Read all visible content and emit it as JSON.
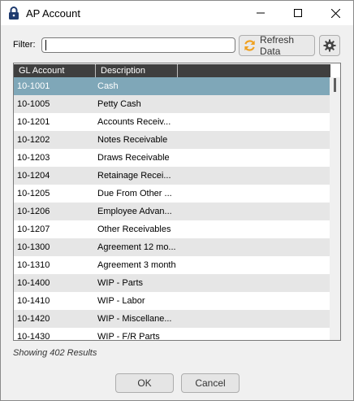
{
  "window": {
    "title": "AP Account"
  },
  "filter": {
    "label": "Filter:",
    "value": ""
  },
  "toolbar": {
    "refresh_label": "Refresh Data"
  },
  "grid": {
    "columns": [
      "GL Account",
      "Description"
    ],
    "rows": [
      {
        "gl": "10-1001",
        "desc": "Cash",
        "selected": true
      },
      {
        "gl": "10-1005",
        "desc": "Petty Cash"
      },
      {
        "gl": "10-1201",
        "desc": "Accounts Receiv..."
      },
      {
        "gl": "10-1202",
        "desc": "Notes Receivable"
      },
      {
        "gl": "10-1203",
        "desc": "Draws Receivable"
      },
      {
        "gl": "10-1204",
        "desc": "Retainage Recei..."
      },
      {
        "gl": "10-1205",
        "desc": "Due From Other ..."
      },
      {
        "gl": "10-1206",
        "desc": "Employee Advan..."
      },
      {
        "gl": "10-1207",
        "desc": "Other Receivables"
      },
      {
        "gl": "10-1300",
        "desc": "Agreement 12 mo..."
      },
      {
        "gl": "10-1310",
        "desc": "Agreement 3 month"
      },
      {
        "gl": "10-1400",
        "desc": "WIP - Parts"
      },
      {
        "gl": "10-1410",
        "desc": "WIP - Labor"
      },
      {
        "gl": "10-1420",
        "desc": "WIP - Miscellane..."
      },
      {
        "gl": "10-1430",
        "desc": "WIP - F/R Parts"
      }
    ]
  },
  "status": {
    "text": "Showing 402 Results"
  },
  "buttons": {
    "ok": "OK",
    "cancel": "Cancel"
  },
  "colors": {
    "selected_row": "#7fa7b8",
    "header": "#3f3f3f",
    "refresh_icon": "#f0a01e"
  },
  "icons": [
    "lock-icon",
    "minimize-icon",
    "maximize-icon",
    "close-icon",
    "refresh-icon",
    "gear-icon"
  ]
}
